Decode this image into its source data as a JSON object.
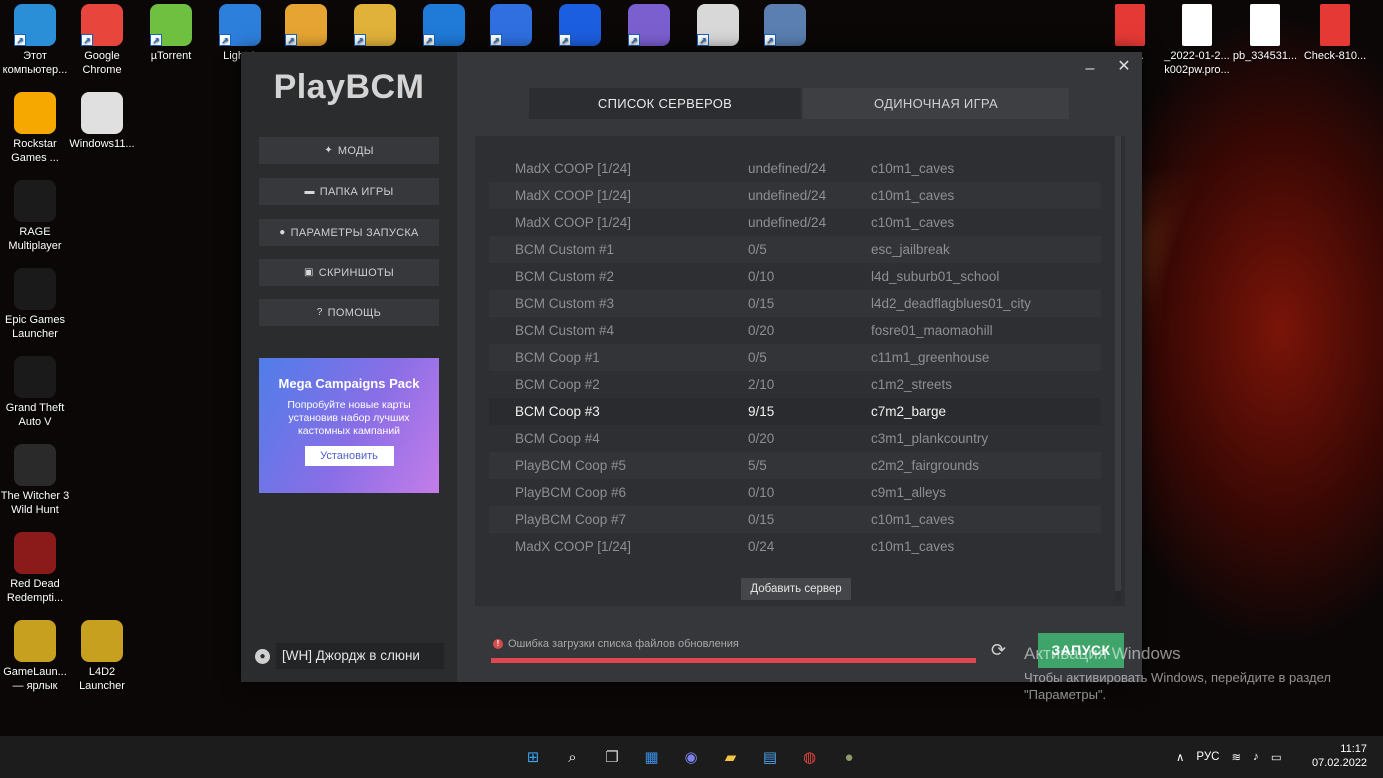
{
  "desktop": {
    "icons_left": [
      {
        "label": "Этот компьютер...",
        "icon": "computer-icon",
        "color": "#2b8fd8"
      },
      {
        "label": "Google Chrome",
        "icon": "chrome-icon",
        "color": "#e8453c"
      },
      {
        "label": "µTorrent",
        "icon": "utorrent-icon",
        "color": "#6fbf40"
      },
      {
        "label": "Light A",
        "icon": "light-alloy-icon",
        "color": "#2d7fdc"
      },
      {
        "label": "",
        "icon": "shortcut-icon",
        "color": "#e6a532"
      },
      {
        "label": "",
        "icon": "picasa-icon",
        "color": "#e0b23a"
      },
      {
        "label": "",
        "icon": "teamviewer-icon",
        "color": "#1f7ad8"
      },
      {
        "label": "",
        "icon": "upload-icon",
        "color": "#2f6fe0"
      },
      {
        "label": "",
        "icon": "upload-blue-icon",
        "color": "#1c5ee0"
      },
      {
        "label": "",
        "icon": "viber-icon",
        "color": "#7b5fcf"
      },
      {
        "label": "",
        "icon": "disk-tool-icon",
        "color": "#d8d8d8"
      },
      {
        "label": "",
        "icon": "sis-icon",
        "color": "#5a7fb0"
      }
    ],
    "icons_column": [
      {
        "label": "Rockstar Games ...",
        "icon": "rockstar-icon",
        "color": "#f6a800"
      },
      {
        "label": "Windows11...",
        "icon": "disc-image-icon",
        "color": "#e0e0e0"
      },
      {
        "label": "RAGE Multiplayer",
        "icon": "rage-mp-icon",
        "color": "#1b1b1b"
      },
      {
        "label": "Epic Games Launcher",
        "icon": "epic-games-icon",
        "color": "#1a1a1a"
      },
      {
        "label": "Grand Theft Auto V",
        "icon": "gta5-icon",
        "color": "#1a1a1a"
      },
      {
        "label": "The Witcher 3 Wild Hunt",
        "icon": "witcher3-icon",
        "color": "#2a2a2a"
      },
      {
        "label": "Red Dead Redempti...",
        "icon": "rdr2-icon",
        "color": "#8b1a1a"
      },
      {
        "label": "GameLaun... — ярлык",
        "icon": "gamelauncher-icon",
        "color": "#c8a020"
      },
      {
        "label": "L4D2 Launcher",
        "icon": "l4d2-launcher-icon",
        "color": "#c8a020"
      }
    ],
    "icons_right": [
      {
        "label": "...ar...",
        "icon": "pdf-icon",
        "color": "#e53935"
      },
      {
        "label": "_2022-01-2... k002pw.pro...",
        "icon": "file-icon",
        "color": "#ffffff"
      },
      {
        "label": "pb_334531...",
        "icon": "file-icon",
        "color": "#ffffff"
      },
      {
        "label": "Check-810...",
        "icon": "pdf-icon",
        "color": "#e53935"
      }
    ]
  },
  "launcher": {
    "logo": "PlayBCM",
    "menu": [
      {
        "label": "МОДЫ",
        "icon": "puzzle-icon",
        "glyph": "✦"
      },
      {
        "label": "ПАПКА ИГРЫ",
        "icon": "folder-icon",
        "glyph": "▬"
      },
      {
        "label": "ПАРАМЕТРЫ ЗАПУСКА",
        "icon": "pin-icon",
        "glyph": "●"
      },
      {
        "label": "СКРИНШОТЫ",
        "icon": "image-icon",
        "glyph": "▣"
      },
      {
        "label": "ПОМОЩЬ",
        "icon": "help-icon",
        "glyph": "?"
      }
    ],
    "promo": {
      "title": "Mega Campaigns Pack",
      "description": "Попробуйте новые карты установив набор лучших кастомных кампаний",
      "button": "Установить"
    },
    "user": {
      "name": "[WH] Джордж в слюни"
    },
    "tabs": [
      {
        "label": "СПИСОК СЕРВЕРОВ",
        "active": true
      },
      {
        "label": "ОДИНОЧНАЯ ИГРА",
        "active": false
      }
    ],
    "window_controls": {
      "minimize": "–",
      "close": "✕"
    },
    "servers": [
      {
        "name": "MadX COOP [1/24]",
        "players": "undefined/24",
        "map": "c10m1_caves"
      },
      {
        "name": "MadX COOP [1/24]",
        "players": "undefined/24",
        "map": "c10m1_caves"
      },
      {
        "name": "MadX COOP [1/24]",
        "players": "undefined/24",
        "map": "c10m1_caves"
      },
      {
        "name": "BCM Custom #1",
        "players": "0/5",
        "map": "esc_jailbreak"
      },
      {
        "name": "BCM Custom #2",
        "players": "0/10",
        "map": "l4d_suburb01_school"
      },
      {
        "name": "BCM Custom #3",
        "players": "0/15",
        "map": "l4d2_deadflagblues01_city"
      },
      {
        "name": "BCM Custom #4",
        "players": "0/20",
        "map": "fosre01_maomaohill"
      },
      {
        "name": "BCM Coop #1",
        "players": "0/5",
        "map": "c11m1_greenhouse"
      },
      {
        "name": "BCM Coop #2",
        "players": "2/10",
        "map": "c1m2_streets"
      },
      {
        "name": "BCM Coop #3",
        "players": "9/15",
        "map": "c7m2_barge",
        "selected": true
      },
      {
        "name": "BCM Coop #4",
        "players": "0/20",
        "map": "c3m1_plankcountry"
      },
      {
        "name": "PlayBCM Coop #5",
        "players": "5/5",
        "map": "c2m2_fairgrounds"
      },
      {
        "name": "PlayBCM Coop #6",
        "players": "0/10",
        "map": "c9m1_alleys"
      },
      {
        "name": "PlayBCM Coop #7",
        "players": "0/15",
        "map": "c10m1_caves"
      },
      {
        "name": "MadX COOP [1/24]",
        "players": "0/24",
        "map": "c10m1_caves"
      }
    ],
    "add_server": "Добавить сервер",
    "status": {
      "text": "Ошибка загрузки списка файлов обновления",
      "progress": 1.0
    },
    "launch": "ЗАПУСК",
    "colors": {
      "accent_green": "#3ea46a",
      "error_red": "#e0464e",
      "promo_from": "#4f7de9",
      "promo_to": "#c47de9"
    }
  },
  "activation": {
    "title": "Активация Windows",
    "text": "Чтобы активировать Windows, перейдите в раздел \"Параметры\"."
  },
  "taskbar": {
    "apps": [
      "windows-start-icon",
      "search-icon",
      "task-view-icon",
      "widgets-icon",
      "teams-chat-icon",
      "file-explorer-icon",
      "store-icon",
      "chrome-icon",
      "l4d2-icon"
    ],
    "language": "РУС",
    "time": "11:17",
    "date": "07.02.2022"
  }
}
